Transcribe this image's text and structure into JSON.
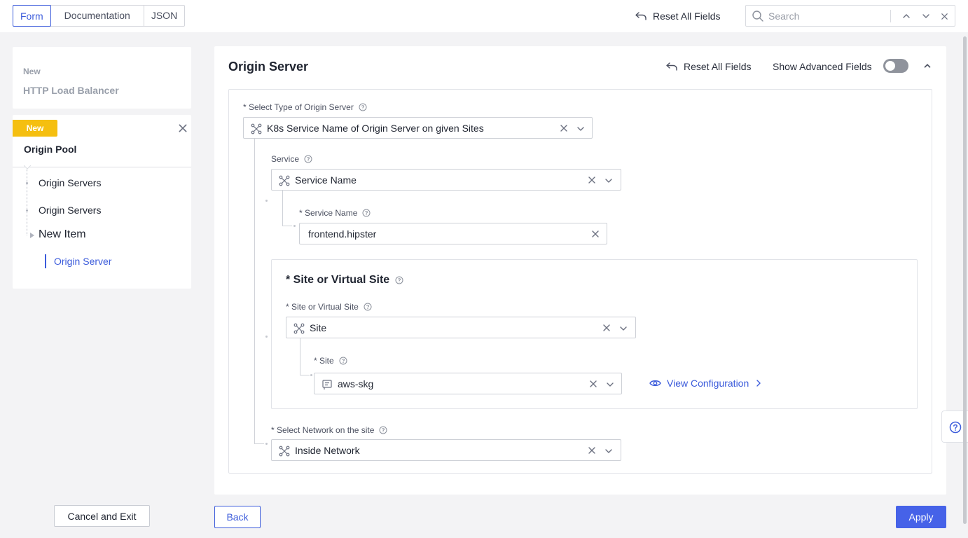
{
  "topbar": {
    "tabs": [
      {
        "label": "Form",
        "active": true
      },
      {
        "label": "Documentation",
        "active": false
      },
      {
        "label": "JSON",
        "active": false
      }
    ],
    "reset_label": "Reset All Fields",
    "search_placeholder": "Search"
  },
  "sidebar": {
    "lb_card": {
      "new_label": "New",
      "title": "HTTP Load Balancer"
    },
    "pool_card": {
      "badge": "New",
      "title": "Origin Pool",
      "nav": [
        {
          "label": "Origin Servers"
        },
        {
          "label": "Origin Servers"
        },
        {
          "label": "New Item"
        }
      ],
      "current": "Origin Server"
    },
    "cancel_label": "Cancel and Exit"
  },
  "panel": {
    "title": "Origin Server",
    "reset_label": "Reset All Fields",
    "advanced_label": "Show Advanced Fields",
    "advanced_enabled": false,
    "origin_type": {
      "label": "* Select Type of Origin Server",
      "value": "K8s Service Name of Origin Server on given Sites"
    },
    "service": {
      "label": "Service",
      "value": "Service Name"
    },
    "service_name": {
      "label": "* Service Name",
      "value": "frontend.hipster"
    },
    "site_section": {
      "title": "* Site or Virtual Site",
      "site_type": {
        "label": "* Site or Virtual Site",
        "value": "Site"
      },
      "site": {
        "label": "* Site",
        "value": "aws-skg"
      },
      "view_config_label": "View Configuration"
    },
    "network": {
      "label": "* Select Network on the site",
      "value": "Inside Network"
    }
  },
  "footer": {
    "back_label": "Back",
    "apply_label": "Apply"
  },
  "colors": {
    "accent": "#3b5bdb",
    "badge": "#f5bf10",
    "apply": "#4662e8"
  }
}
